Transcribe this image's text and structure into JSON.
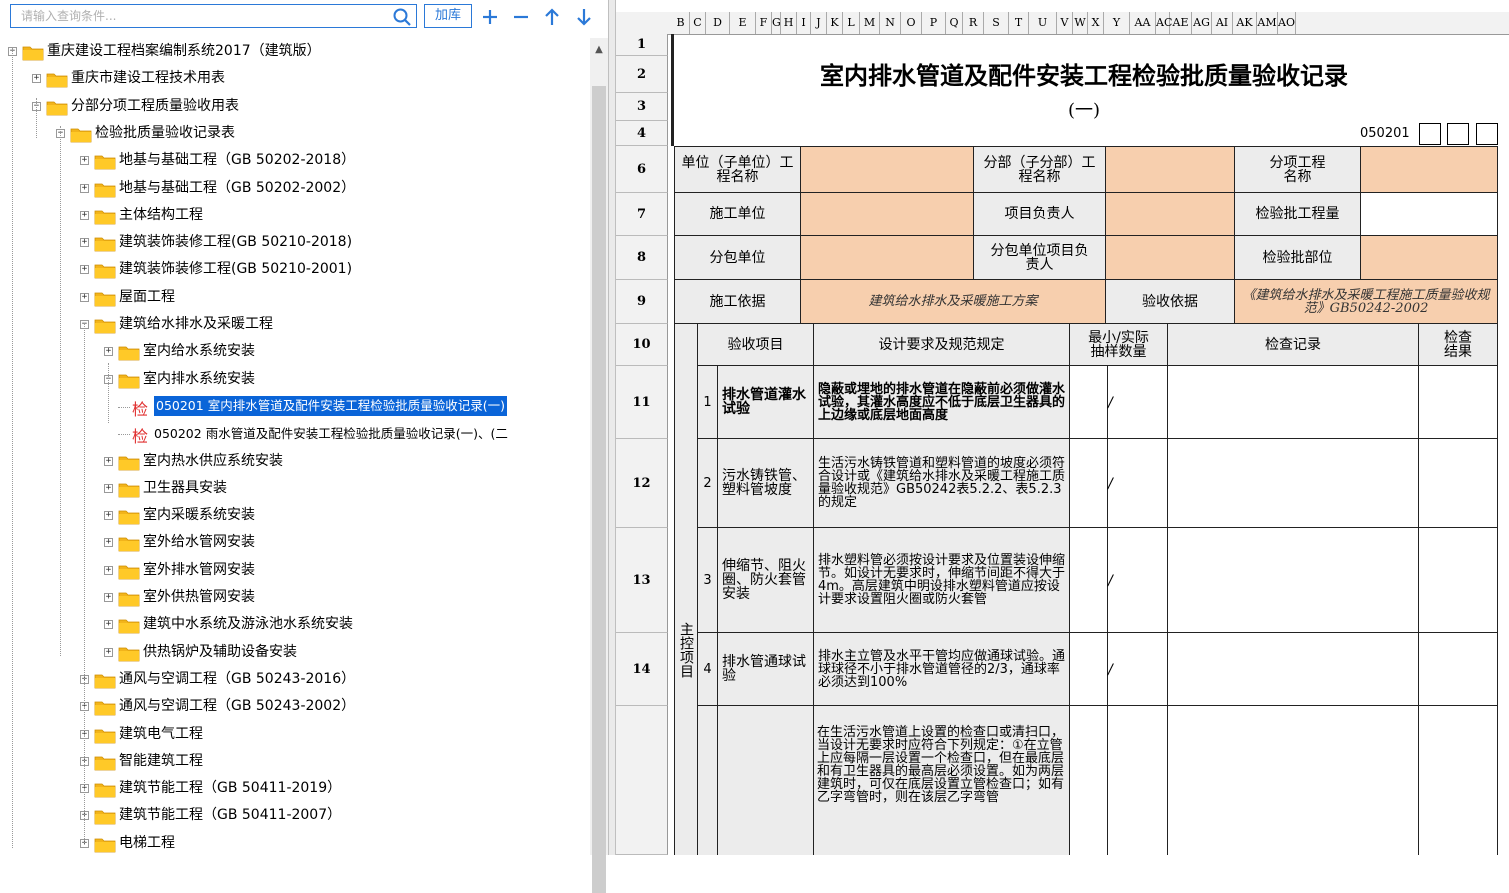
{
  "search": {
    "placeholder": "请输入查询条件..."
  },
  "toolbar": {
    "lib_label": "加库"
  },
  "tree": {
    "items": [
      {
        "label": "重庆建设工程档案编制系统2017（建筑版）"
      },
      {
        "label": "重庆市建设工程技术用表"
      },
      {
        "label": "分部分项工程质量验收用表"
      },
      {
        "label": "检验批质量验收记录表"
      },
      {
        "label": "地基与基础工程（GB 50202-2018）"
      },
      {
        "label": "地基与基础工程（GB 50202-2002）"
      },
      {
        "label": "主体结构工程"
      },
      {
        "label": "建筑装饰装修工程(GB 50210-2018)"
      },
      {
        "label": "建筑装饰装修工程(GB 50210-2001)"
      },
      {
        "label": "屋面工程"
      },
      {
        "label": "建筑给水排水及采暖工程"
      },
      {
        "label": "室内给水系统安装"
      },
      {
        "label": "室内排水系统安装"
      },
      {
        "glyph": "检",
        "label": "050201 室内排水管道及配件安装工程检验批质量验收记录(一)"
      },
      {
        "glyph": "检",
        "label": "050202 雨水管道及配件安装工程检验批质量验收记录(一)、(二"
      },
      {
        "label": "室内热水供应系统安装"
      },
      {
        "label": "卫生器具安装"
      },
      {
        "label": "室内采暖系统安装"
      },
      {
        "label": "室外给水管网安装"
      },
      {
        "label": "室外排水管网安装"
      },
      {
        "label": "室外供热管网安装"
      },
      {
        "label": "建筑中水系统及游泳池水系统安装"
      },
      {
        "label": "供热锅炉及辅助设备安装"
      },
      {
        "label": "通风与空调工程（GB 50243-2016）"
      },
      {
        "label": "通风与空调工程（GB 50243-2002）"
      },
      {
        "label": "建筑电气工程"
      },
      {
        "label": "智能建筑工程"
      },
      {
        "label": "建筑节能工程（GB 50411-2019）"
      },
      {
        "label": "建筑节能工程（GB 50411-2007）"
      },
      {
        "label": "电梯工程"
      }
    ]
  },
  "sheet": {
    "columns": [
      "B",
      "C",
      "D",
      "E",
      "F",
      "G",
      "H",
      "I",
      "J",
      "K",
      "L",
      "M",
      "N",
      "O",
      "P",
      "Q",
      "R",
      "S",
      "T",
      "U",
      "V",
      "W",
      "X",
      "Y",
      "AA",
      "AC",
      "AE",
      "AG",
      "AI",
      "AK",
      "AM",
      "AO"
    ],
    "rows": [
      "1",
      "2",
      "3",
      "4",
      "6",
      "7",
      "8",
      "9",
      "10",
      "11",
      "12",
      "13",
      "14"
    ],
    "title": "室内排水管道及配件安装工程检验批质量验收记录",
    "subtitle": "(一)",
    "code": "050201",
    "r6": {
      "a": "单位（子单位）工程名称",
      "b": "分部（子分部）工程名称",
      "c": "分项工程名称"
    },
    "r7": {
      "a": "施工单位",
      "b": "项目负责人",
      "c": "检验批工程量"
    },
    "r8": {
      "a": "分包单位",
      "b": "分包单位项目负责人",
      "c": "检验批部位"
    },
    "r9": {
      "a": "施工依据",
      "a_val": "建筑给水排水及采暖施工方案",
      "b": "验收依据",
      "b_val": "《建筑给水排水及采暖工程施工质量验收规范》GB50242-2002"
    },
    "r10": {
      "item": "验收项目",
      "req": "设计要求及规范规定",
      "qty": "最小/实际抽样数量",
      "record": "检查记录",
      "result": "检查结果"
    },
    "main_items_label": "主控项目",
    "items": [
      {
        "no": "1",
        "name": "排水管道灌水试验",
        "req": "隐蔽或埋地的排水管道在隐蔽前必须做灌水试验，其灌水高度应不低于底层卫生器具的上边缘或底层地面高度",
        "slash": "/"
      },
      {
        "no": "2",
        "name": "污水铸铁管、塑料管坡度",
        "req": "生活污水铸铁管道和塑料管道的坡度必须符合设计或《建筑给水排水及采暖工程施工质量验收规范》GB50242表5.2.2、表5.2.3的规定",
        "slash": "/"
      },
      {
        "no": "3",
        "name": "伸缩节、阻火圈、防火套管安装",
        "req": "排水塑料管必须按设计要求及位置装设伸缩节。如设计无要求时，伸缩节间距不得大于4m。高层建筑中明设排水塑料管道应按设计要求设置阻火圈或防火套管",
        "slash": "/"
      },
      {
        "no": "4",
        "name": "排水管通球试验",
        "req": "排水主立管及水平干管均应做通球试验。通球球径不小于排水管道管径的2/3，通球率必须达到100%",
        "slash": "/"
      }
    ],
    "row15_req": "在生活污水管道上设置的检查口或清扫口，当设计无要求时应符合下列规定：①在立管上应每隔一层设置一个检查口，但在最底层和有卫生器具的最高层必须设置。如为两层建筑时，可仅在底层设置立管检查口；如有乙字弯管时，则在该层乙字弯管"
  }
}
